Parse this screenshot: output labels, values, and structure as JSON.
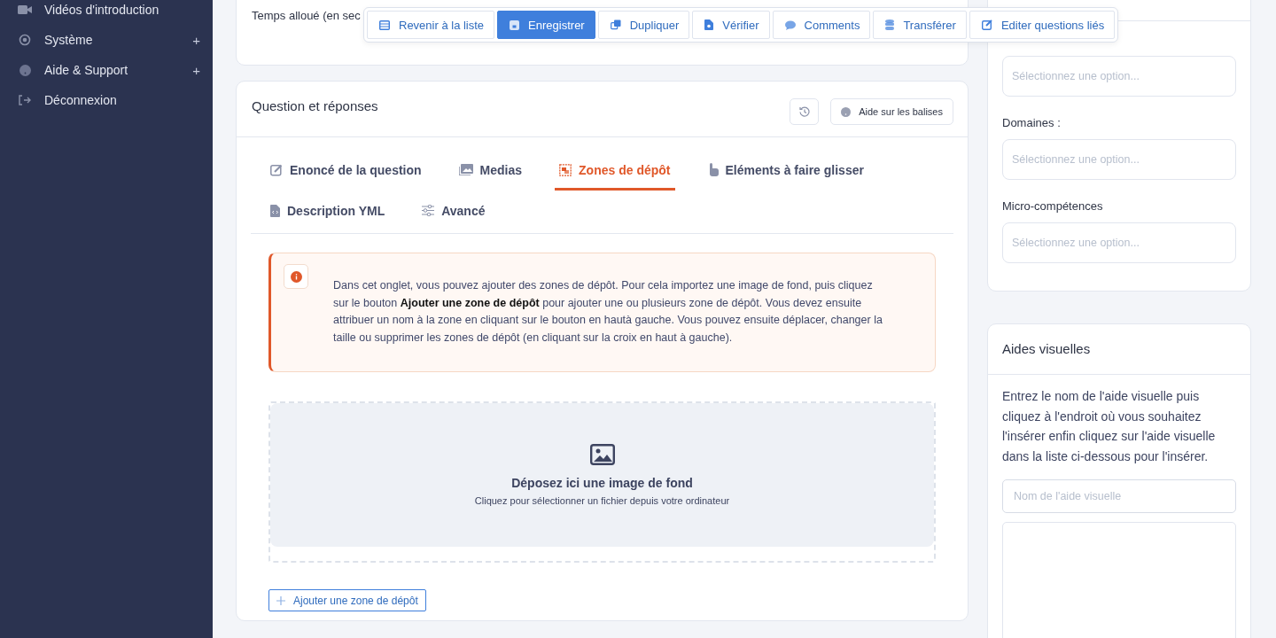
{
  "sidebar": {
    "items": [
      {
        "label": "Vidéos d'introduction"
      },
      {
        "label": "Système",
        "toggle": "+"
      },
      {
        "label": "Aide & Support",
        "toggle": "+"
      },
      {
        "label": "Déconnexion"
      }
    ]
  },
  "top_card": {
    "label": "Temps alloué (en sec"
  },
  "toolbar": [
    {
      "label": "Revenir à la liste",
      "primary": false
    },
    {
      "label": "Enregistrer",
      "primary": true
    },
    {
      "label": "Dupliquer",
      "primary": false
    },
    {
      "label": "Vérifier",
      "primary": false
    },
    {
      "label": "Comments",
      "primary": false
    },
    {
      "label": "Transférer",
      "primary": false
    },
    {
      "label": "Editer questions liés",
      "primary": false
    }
  ],
  "question_card": {
    "title": "Question et réponses",
    "help_button": "Aide sur les balises",
    "tabs": [
      {
        "label": "Enoncé de la question",
        "selected": false
      },
      {
        "label": "Medias",
        "selected": false
      },
      {
        "label": "Zones de dépôt",
        "selected": true
      },
      {
        "label": "Eléments à faire glisser",
        "selected": false
      },
      {
        "label": "Description YML",
        "selected": false
      },
      {
        "label": "Avancé",
        "selected": false
      }
    ],
    "alert": "Dans cet onglet, vous pouvez ajouter des zones de dépôt. Pour cela importez une image de fond, puis cliquez sur le bouton **Ajouter une zone de dépôt** pour ajouter une ou plusieurs zone de dépôt. Vous devez ensuite attribuer un nom à la zone en cliquant sur le bouton en hautà gauche. Vous pouvez ensuite déplacer, changer la taille ou supprimer les zones de dépôt (en cliquant sur la croix en haut à gauche).",
    "dropzone": {
      "title": "Déposez ici une image de fond",
      "subtitle": "Cliquez pour sélectionner un fichier depuis votre ordinateur"
    },
    "add_button": "Ajouter une zone de dépôt"
  },
  "classification_card": {
    "fields": [
      {
        "placeholder": "Sélectionnez une option..."
      },
      {
        "label": "Domaines :",
        "placeholder": "Sélectionnez une option..."
      },
      {
        "label": "Micro-compétences",
        "placeholder": "Sélectionnez une option..."
      }
    ]
  },
  "visual_aids_card": {
    "title": "Aides visuelles",
    "description": "Entrez le nom de l'aide visuelle puis cliquez à l'endroit où vous souhaitez l'insérer enfin cliquez sur l'aide visuelle dans la liste ci-dessous pour l'insérer.",
    "name_field": {
      "placeholder": "Nom de l'aide visuelle"
    }
  }
}
